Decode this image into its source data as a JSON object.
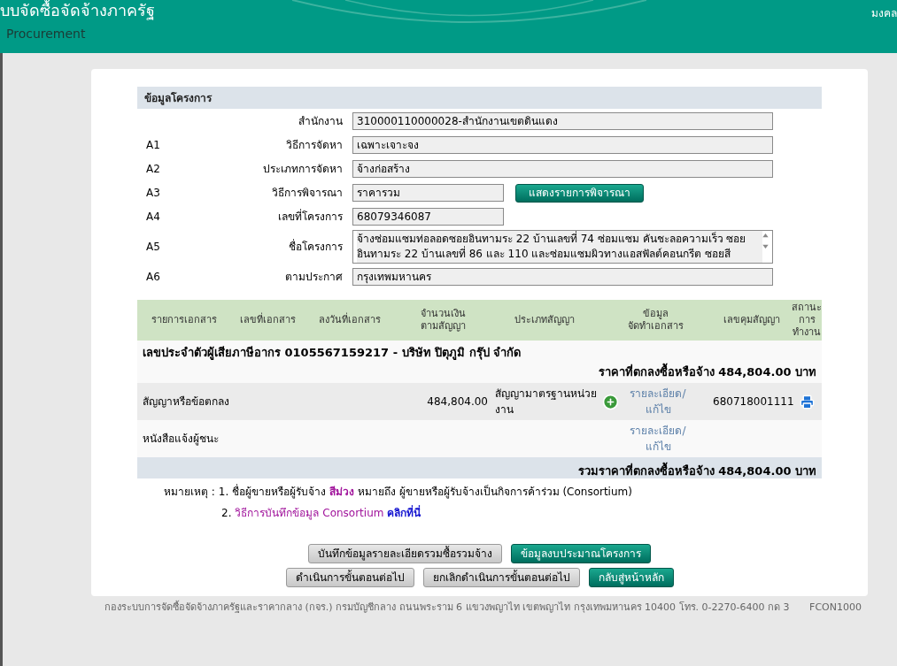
{
  "header": {
    "title": "บบจัดซื้อจัดจ้างภาครัฐ",
    "subtitle": "Procurement",
    "user": "มงคล"
  },
  "project": {
    "title": "ข้อมูลโครงการ",
    "fields": [
      {
        "label": "สำนักงาน",
        "value": "310000110000028-สำนักงานเขตดินแดง",
        "kind": "text"
      },
      {
        "code": "A1",
        "label": "วิธีการจัดหา",
        "value": "เฉพาะเจาะจง",
        "kind": "text"
      },
      {
        "code": "A2",
        "label": "ประเภทการจัดหา",
        "value": "จ้างก่อสร้าง",
        "kind": "text"
      },
      {
        "code": "A3",
        "label": "วิธีการพิจารณา",
        "value": "ราคารวม",
        "kind": "short",
        "button": "แสดงรายการพิจารณา"
      },
      {
        "code": "A4",
        "label": "เลขที่โครงการ",
        "value": "68079346087",
        "kind": "short"
      },
      {
        "code": "A5",
        "label": "ชื่อโครงการ",
        "value": "จ้างซ่อมแซมท่อลอดซอยอินทามระ 22 บ้านเลขที่ 74  ซ่อมแซม คันชะลอความเร็ว ซอยอินทามระ 22 บ้านเลขที่ 86 และ 110 และซ่อมแซมผิวทางแอสฟัลต์คอนกรีต    ซอยสี",
        "kind": "textarea"
      },
      {
        "code": "A6",
        "label": "ตามประกาศ",
        "value": "กรุงเทพมหานคร",
        "kind": "text"
      }
    ]
  },
  "table": {
    "columns": [
      "รายการเอกสาร",
      "เลขที่เอกสาร",
      "ลงวันที่เอกสาร",
      "จำนวนเงิน\nตามสัญญา",
      "ประเภทสัญญา",
      "ข้อมูล\nจัดทำเอกสาร",
      "เลขคุมสัญญา",
      "สถานะ\nการ\nทำงาน"
    ],
    "vendor": "เลขประจำตัวผู้เสียภาษีอากร 0105567159217 - บริษัท ปิตุภูมิ กรุ๊ป จำกัด",
    "agreed_price": "ราคาที่ตกลงซื้อหรือจ้าง 484,804.00 บาท",
    "rows": [
      {
        "document": "สัญญาหรือข้อตกลง",
        "amount": "484,804.00",
        "contract_type": "สัญญามาตรฐานหน่วยงาน",
        "add_button": true,
        "detail_link": "รายละเอียด/แก้ไข",
        "control_no": "680718001111",
        "status_icon": true
      },
      {
        "document": "หนังสือแจ้งผู้ชนะ",
        "amount": "",
        "contract_type": "",
        "add_button": false,
        "detail_link": "รายละเอียด/แก้ไข",
        "control_no": "",
        "status_icon": false
      }
    ],
    "total": "รวมราคาที่ตกลงซื้อหรือจ้าง 484,804.00 บาท"
  },
  "notes": {
    "label": "หมายเหตุ :",
    "note_1": "1. ชื่อผู้ขายหรือผู้รับจ้าง **สีม่วง** หมายถึง ผู้ขายหรือผู้รับจ้างเป็นกิจการค้าร่วม (Consortium)",
    "note_2_number": "2.",
    "note_2_text": "วิธีการบันทึกข้อมูล Consortium",
    "note_2_link": "คลิกที่นี่"
  },
  "button_rows": [
    [
      {
        "label": "บันทึกข้อมูลรายละเอียดรวมซื้อรวมจ้าง",
        "kind": "gray"
      },
      {
        "label": "ข้อมูลงบประมาณโครงการ",
        "kind": "teal"
      }
    ],
    [
      {
        "label": "ดำเนินการขั้นตอนต่อไป",
        "kind": "gray"
      },
      {
        "label": "ยกเลิกดำเนินการขั้นตอนต่อไป",
        "kind": "gray"
      },
      {
        "label": "กลับสู่หน้าหลัก",
        "kind": "teal"
      }
    ]
  ],
  "footer": {
    "text": "กองระบบการจัดซื้อจัดจ้างภาครัฐและราคากลาง (กจร.) กรมบัญชีกลาง ถนนพระราม 6 แขวงพญาไท เขตพญาไท กรุงเทพมหานคร 10400 โทร. 0-2270-6400 กด 3",
    "code": "FCON1000"
  }
}
